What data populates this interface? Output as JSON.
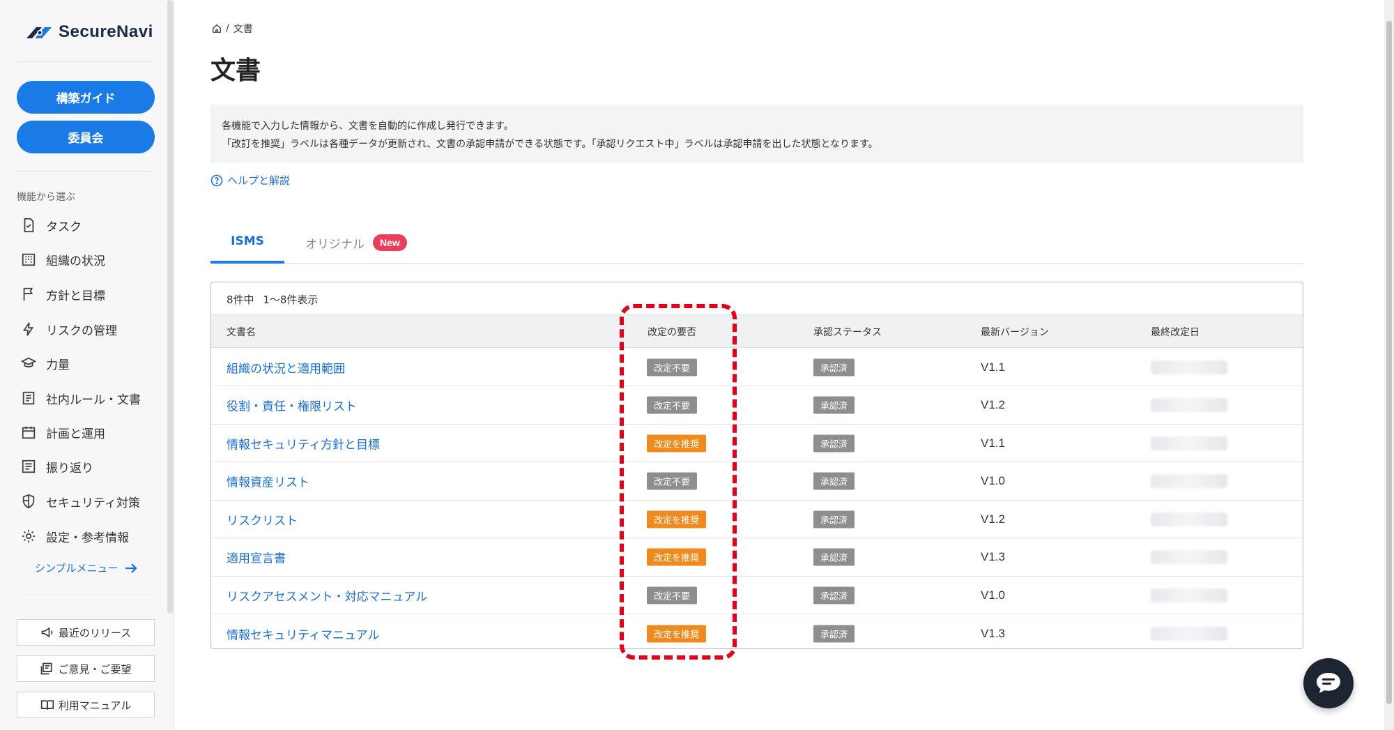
{
  "brand": {
    "name": "SecureNavi"
  },
  "sidebar": {
    "primary_buttons": [
      "構築ガイド",
      "委員会"
    ],
    "section_label": "機能から選ぶ",
    "items": [
      {
        "label": "タスク",
        "icon": "task-icon"
      },
      {
        "label": "組織の状況",
        "icon": "building-icon"
      },
      {
        "label": "方針と目標",
        "icon": "flag-icon"
      },
      {
        "label": "リスクの管理",
        "icon": "lightning-icon"
      },
      {
        "label": "力量",
        "icon": "graduation-cap-icon"
      },
      {
        "label": "社内ルール・文書",
        "icon": "document-icon"
      },
      {
        "label": "計画と運用",
        "icon": "calendar-icon"
      },
      {
        "label": "振り返り",
        "icon": "review-icon"
      },
      {
        "label": "セキュリティ対策",
        "icon": "shield-icon"
      },
      {
        "label": "設定・参考情報",
        "icon": "gear-icon"
      }
    ],
    "simple_menu": "シンプルメニュー",
    "bottom_buttons": [
      "最近のリリース",
      "ご意見・ご要望",
      "利用マニュアル"
    ]
  },
  "breadcrumb": {
    "current": "文書"
  },
  "page": {
    "title": "文書",
    "info_lines": [
      "各機能で入力した情報から、文書を自動的に作成し発行できます。",
      "「改訂を推奨」ラベルは各種データが更新され、文書の承認申請ができる状態です。「承認リクエスト中」ラベルは承認申請を出した状態となります。"
    ],
    "help_link": "ヘルプと解説"
  },
  "tabs": {
    "isms": "ISMS",
    "original": "オリジナル",
    "new_badge": "New"
  },
  "table": {
    "count_total": "8件中",
    "count_range": "1〜8件表示",
    "headers": [
      "文書名",
      "改定の要否",
      "承認ステータス",
      "最新バージョン",
      "最終改定日"
    ],
    "colors": {
      "not_required": "#8e8e8e",
      "recommended": "#f08a1c",
      "approved": "#8e8e8e"
    },
    "rows": [
      {
        "name": "組織の状況と適用範囲",
        "revision": "改定不要",
        "revision_kind": "not_required",
        "status": "承認済",
        "version": "V1.1"
      },
      {
        "name": "役割・責任・権限リスト",
        "revision": "改定不要",
        "revision_kind": "not_required",
        "status": "承認済",
        "version": "V1.2"
      },
      {
        "name": "情報セキュリティ方針と目標",
        "revision": "改定を推奨",
        "revision_kind": "recommended",
        "status": "承認済",
        "version": "V1.1"
      },
      {
        "name": "情報資産リスト",
        "revision": "改定不要",
        "revision_kind": "not_required",
        "status": "承認済",
        "version": "V1.0"
      },
      {
        "name": "リスクリスト",
        "revision": "改定を推奨",
        "revision_kind": "recommended",
        "status": "承認済",
        "version": "V1.2"
      },
      {
        "name": "適用宣言書",
        "revision": "改定を推奨",
        "revision_kind": "recommended",
        "status": "承認済",
        "version": "V1.3"
      },
      {
        "name": "リスクアセスメント・対応マニュアル",
        "revision": "改定不要",
        "revision_kind": "not_required",
        "status": "承認済",
        "version": "V1.0"
      },
      {
        "name": "情報セキュリティマニュアル",
        "revision": "改定を推奨",
        "revision_kind": "recommended",
        "status": "承認済",
        "version": "V1.3"
      }
    ]
  }
}
